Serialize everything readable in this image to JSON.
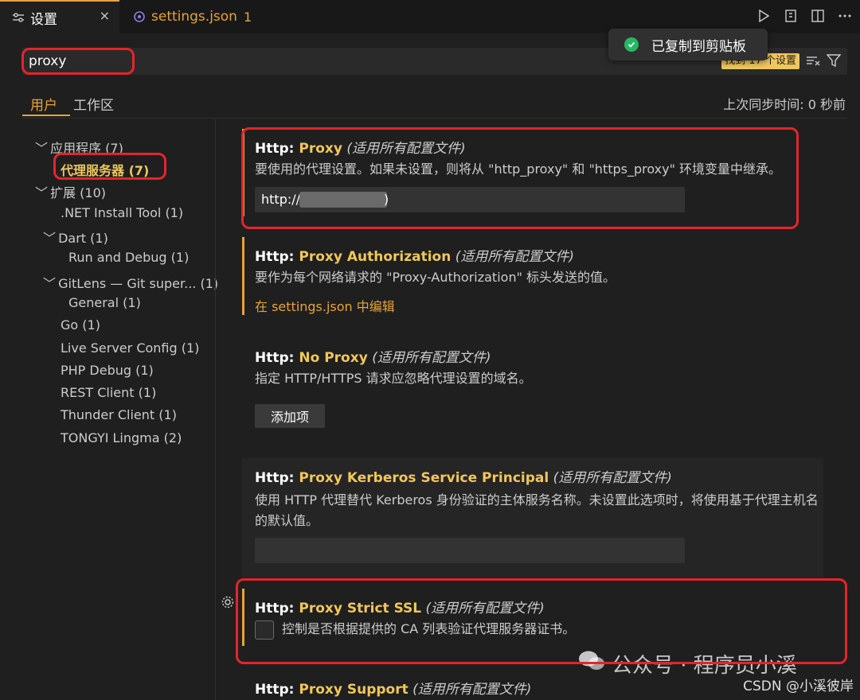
{
  "tabs": [
    {
      "label": "设置",
      "icon": "settings-sliders-icon"
    },
    {
      "label": "settings.json",
      "badge": "1",
      "icon": "json-brace-icon"
    }
  ],
  "tab_close": "×",
  "editor_actions": [
    "run-icon",
    "open-json-icon",
    "split-editor-icon",
    "more-icon"
  ],
  "toast": {
    "text": "已复制到剪贴板",
    "icon": "check-circle-icon"
  },
  "search": {
    "value": "proxy",
    "found": "找到 17 个设置"
  },
  "scope_tabs": {
    "user": "用户",
    "workspace": "工作区"
  },
  "sync": "上次同步时间: 0 秒前",
  "toc": [
    {
      "label": "应用程序 (7)",
      "chevron": "﹀"
    },
    {
      "label": "代理服务器 (7)"
    },
    {
      "label": "扩展 (10)",
      "chevron": "﹀"
    },
    {
      "label": ".NET Install Tool (1)"
    },
    {
      "label": "Dart (1)",
      "chevron": "﹀"
    },
    {
      "label": "Run and Debug (1)"
    },
    {
      "label": "GitLens — Git super... (1)",
      "chevron": "﹀"
    },
    {
      "label": "General (1)"
    },
    {
      "label": "Go (1)"
    },
    {
      "label": "Live Server Config (1)"
    },
    {
      "label": "PHP Debug (1)"
    },
    {
      "label": "REST Client (1)"
    },
    {
      "label": "Thunder Client (1)"
    },
    {
      "label": "TONGYI Lingma (2)"
    }
  ],
  "settings": [
    {
      "category": "Http: ",
      "name": "Proxy",
      "scope": "(适用所有配置文件)",
      "desc": "要使用的代理设置。如果未设置，则将从 \"http_proxy\" 和 \"https_proxy\" 环境变量中继承。",
      "input_value": "http://",
      "input_tail": ")"
    },
    {
      "category": "Http: ",
      "name": "Proxy Authorization",
      "scope": "(适用所有配置文件)",
      "desc": "要作为每个网络请求的 \"Proxy-Authorization\" 标头发送的值。",
      "link": "在 settings.json 中编辑"
    },
    {
      "category": "Http: ",
      "name": "No Proxy",
      "scope": "(适用所有配置文件)",
      "desc": "指定 HTTP/HTTPS 请求应忽略代理设置的域名。",
      "button": "添加项"
    },
    {
      "category": "Http: ",
      "name": "Proxy Kerberos Service Principal",
      "scope": "(适用所有配置文件)",
      "desc": "使用 HTTP 代理替代 Kerberos 身份验证的主体服务名称。未设置此选项时，将使用基于代理主机名的默认值。",
      "input_value": ""
    },
    {
      "category": "Http: ",
      "name": "Proxy Strict SSL",
      "scope": "(适用所有配置文件)",
      "desc": "控制是否根据提供的 CA 列表验证代理服务器证书。",
      "checked": false
    },
    {
      "category": "Http: ",
      "name": "Proxy Support",
      "scope": "(适用所有配置文件)"
    }
  ],
  "watermark": "公众号 · 程序员小溪",
  "csdn": "CSDN @小溪彼岸",
  "colors": {
    "accent": "#e5a43a",
    "highlight_box": "#e3252b",
    "toast_ok": "#25b863",
    "background": "#1f1f1f"
  }
}
